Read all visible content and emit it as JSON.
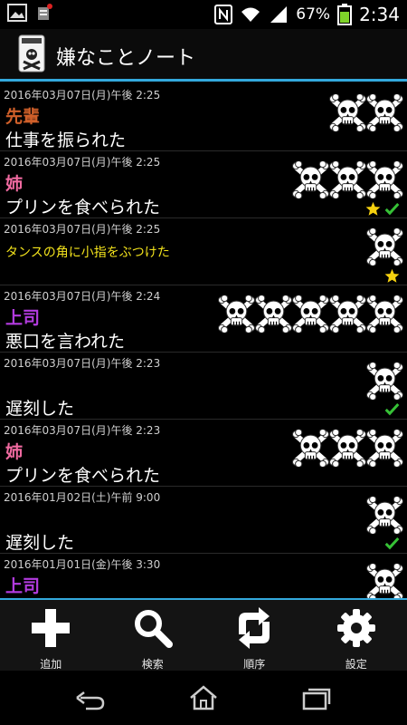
{
  "status": {
    "battery_percent": "67%",
    "time": "2:34"
  },
  "app": {
    "title": "嫌なことノート"
  },
  "entries": [
    {
      "date": "2016年03月07日(月)午後 2:25",
      "who": "先輩",
      "who_color": "#d0602a",
      "what": "仕事を振られた",
      "skulls": 2,
      "star": false,
      "check": false,
      "small": false
    },
    {
      "date": "2016年03月07日(月)午後 2:25",
      "who": "姉",
      "who_color": "#f06aa0",
      "what": "プリンを食べられた",
      "skulls": 3,
      "star": true,
      "check": true,
      "small": false
    },
    {
      "date": "2016年03月07日(月)午後 2:25",
      "who": "",
      "who_color": "",
      "what": "タンスの角に小指をぶつけた",
      "what_color": "#f2e21c",
      "skulls": 1,
      "star": true,
      "check": false,
      "small": true
    },
    {
      "date": "2016年03月07日(月)午後 2:24",
      "who": "上司",
      "who_color": "#b43ce0",
      "what": "悪口を言われた",
      "skulls": 5,
      "star": false,
      "check": false,
      "small": false
    },
    {
      "date": "2016年03月07日(月)午後 2:23",
      "who": "",
      "who_color": "",
      "what": "遅刻した",
      "skulls": 1,
      "star": false,
      "check": true,
      "small": false
    },
    {
      "date": "2016年03月07日(月)午後 2:23",
      "who": "姉",
      "who_color": "#f06aa0",
      "what": "プリンを食べられた",
      "skulls": 3,
      "star": false,
      "check": false,
      "small": false
    },
    {
      "date": "2016年01月02日(土)午前 9:00",
      "who": "",
      "who_color": "",
      "what": "遅刻した",
      "skulls": 1,
      "star": false,
      "check": true,
      "small": false
    },
    {
      "date": "2016年01月01日(金)午後 3:30",
      "who": "上司",
      "who_color": "#b43ce0",
      "what": "",
      "skulls": 1,
      "star": false,
      "check": false,
      "small": false
    }
  ],
  "toolbar": {
    "add_label": "追加",
    "search_label": "検索",
    "order_label": "順序",
    "settings_label": "設定"
  },
  "icons": {
    "gallery": "gallery-icon",
    "notification": "notification-icon",
    "nfc": "nfc-icon",
    "wifi": "wifi-icon",
    "signal": "signal-icon",
    "battery": "battery-icon",
    "skull": "skull-crossbones-icon",
    "star": "star-icon",
    "check": "check-icon",
    "add": "plus-icon",
    "search": "magnifier-icon",
    "order": "sort-arrows-icon",
    "settings": "gear-icon",
    "back": "back-icon",
    "home": "home-icon",
    "recents": "recents-icon"
  },
  "colors": {
    "accent": "#33a9dd",
    "star": "#f5d10f",
    "check": "#36c136"
  }
}
